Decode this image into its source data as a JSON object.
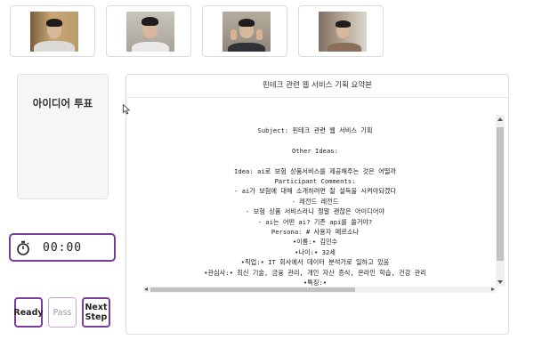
{
  "participants": [
    {
      "name": "participant-1-video",
      "bg": "#b89a6c"
    },
    {
      "name": "participant-2-video",
      "bg": "#a9a49a"
    },
    {
      "name": "participant-3-video",
      "bg": "#a59f8d"
    },
    {
      "name": "participant-4-video",
      "bg": "#9b8f82"
    }
  ],
  "vote_panel": {
    "title": "아이디어 투표"
  },
  "timer": {
    "icon": "stopwatch-icon",
    "value": "00:00"
  },
  "buttons": {
    "ready": "Ready",
    "pass": "Pass",
    "next_step": "Next Step"
  },
  "summary": {
    "title": "핀테크 관련 웹 서비스 기획 요약본",
    "text": "Subject: 핀테크 관련 웹 서비스 기획\n\nOther Ideas:\n\nIdea: ai로 보험 상품서비스를 제공해주는 것은 어떨까\nParticipant Comments:\n- ai가 보험에 대해 소개하려면 잘 설득을 시켜야되겠다\n- 레전드 레전드\n- 보험 상품 서비스라니 정말 괜찮은 아이디어야\n- ai는 어떤 ai? 기존 api를 쓸거야?\nPersona: # 사용자 페르소나\n•이름:• 김민수\n•나이:• 32세\n•직업:• IT 회사에서 데이터 분석가로 일하고 있음\n•관심사:• 최신 기술, 금융 관리, 개인 자산 증식, 온라인 학습, 건강 관리\n•특징:•"
  },
  "colors": {
    "accent": "#7b3b99"
  }
}
